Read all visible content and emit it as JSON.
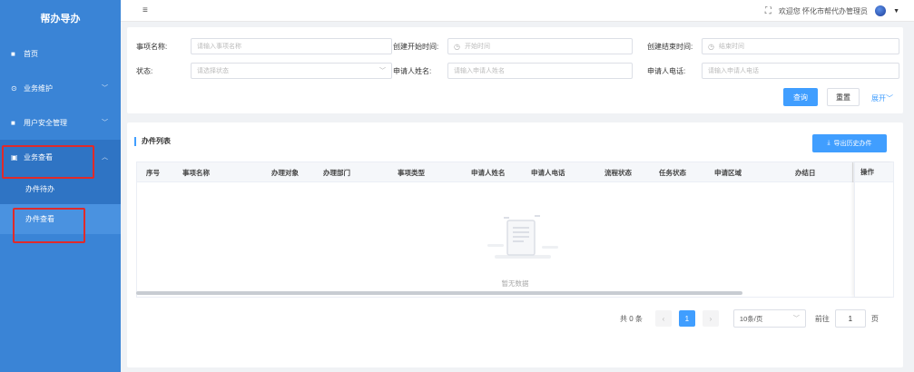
{
  "app": {
    "title": "帮办导办"
  },
  "sidebar": {
    "items": [
      {
        "label": "首页",
        "icon": "home-icon"
      },
      {
        "label": "业务维护",
        "icon": "settings-icon"
      },
      {
        "label": "用户安全管理",
        "icon": "user-shield-icon"
      },
      {
        "label": "业务查看",
        "icon": "document-icon"
      }
    ],
    "submenu": [
      {
        "label": "办件待办"
      },
      {
        "label": "办件查看"
      }
    ]
  },
  "header": {
    "menu_icon": "≡",
    "welcome": "欢迎您 怀化市帮代办管理员"
  },
  "search": {
    "fields": {
      "item_name": {
        "label": "事项名称:",
        "placeholder": "请输入事项名称"
      },
      "create_start": {
        "label": "创建开始时间:",
        "placeholder": "开始时间"
      },
      "create_end": {
        "label": "创建结束时间:",
        "placeholder": "结束时间"
      },
      "status": {
        "label": "状态:",
        "placeholder": "请选择状态"
      },
      "applicant_name": {
        "label": "申请人姓名:",
        "placeholder": "请输入申请人姓名"
      },
      "applicant_phone": {
        "label": "申请人电话:",
        "placeholder": "请输入申请人电话"
      }
    },
    "query_label": "查询",
    "reset_label": "重置",
    "expand_label": "展开"
  },
  "list": {
    "title": "办件列表",
    "export_label": "导出历史办件",
    "columns": [
      "序号",
      "事项名称",
      "办理对象",
      "办理部门",
      "事项类型",
      "申请人姓名",
      "申请人电话",
      "流程状态",
      "任务状态",
      "申请区域",
      "办结日"
    ],
    "fixed_column": "操作",
    "empty_text": "暂无数据"
  },
  "pagination": {
    "total": "共 0 条",
    "current_page": "1",
    "page_size": "10条/页",
    "goto_label": "前往",
    "goto_value": "1",
    "page_unit": "页"
  },
  "colors": {
    "sidebar": "#3a84d6",
    "primary": "#409eff",
    "highlight": "#e02a2a"
  }
}
